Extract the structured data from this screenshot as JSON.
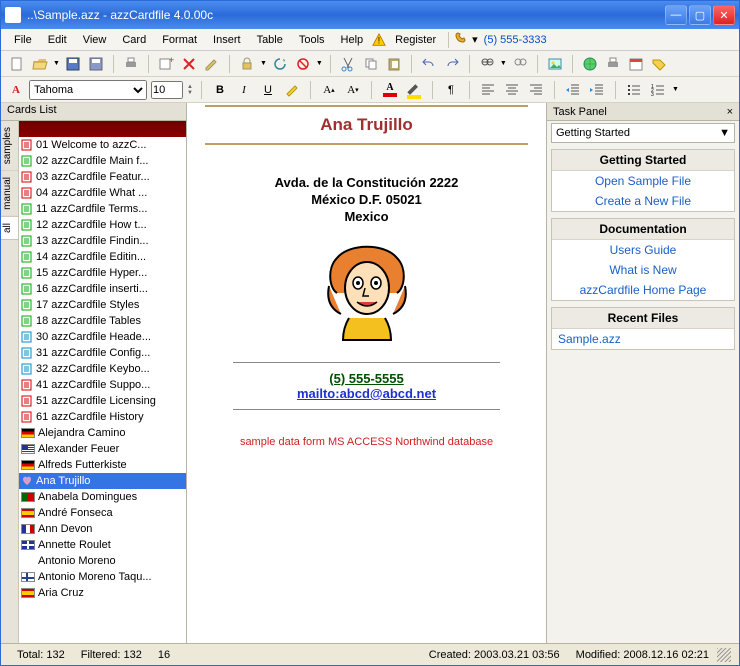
{
  "window": {
    "title": "..\\Sample.azz - azzCardfile 4.0.00c"
  },
  "menu": {
    "items": [
      "File",
      "Edit",
      "View",
      "Card",
      "Format",
      "Insert",
      "Table",
      "Tools",
      "Help"
    ],
    "register": "Register",
    "dial_icon": "phone-icon",
    "dial_number": "(5) 555-3333"
  },
  "format": {
    "font": "Tahoma",
    "size": "10"
  },
  "cards_panel": {
    "title": "Cards List",
    "tabs": [
      "all",
      "manual",
      "samples"
    ],
    "items": [
      {
        "kind": "doc",
        "color": "#c00",
        "label": "01 Welcome to azzC..."
      },
      {
        "kind": "doc",
        "color": "#0a0",
        "label": "02 azzCardfile Main f..."
      },
      {
        "kind": "doc",
        "color": "#c00",
        "label": "03 azzCardfile Featur..."
      },
      {
        "kind": "doc",
        "color": "#c00",
        "label": "04 azzCardfile What ..."
      },
      {
        "kind": "doc",
        "color": "#0a0",
        "label": "11 azzCardfile Terms..."
      },
      {
        "kind": "doc",
        "color": "#0a0",
        "label": "12 azzCardfile How t..."
      },
      {
        "kind": "doc",
        "color": "#0a0",
        "label": "13 azzCardfile Findin..."
      },
      {
        "kind": "doc",
        "color": "#0a0",
        "label": "14 azzCardfile Editin..."
      },
      {
        "kind": "doc",
        "color": "#0a0",
        "label": "15 azzCardfile Hyper..."
      },
      {
        "kind": "doc",
        "color": "#0a0",
        "label": "16 azzCardfile inserti..."
      },
      {
        "kind": "doc",
        "color": "#0a0",
        "label": "17 azzCardfile Styles"
      },
      {
        "kind": "doc",
        "color": "#0a0",
        "label": "18 azzCardfile Tables"
      },
      {
        "kind": "doc",
        "color": "#08c",
        "label": "30 azzCardfile Heade..."
      },
      {
        "kind": "doc",
        "color": "#08c",
        "label": "31 azzCardfile Config..."
      },
      {
        "kind": "doc",
        "color": "#08c",
        "label": "32 azzCardfile Keybo..."
      },
      {
        "kind": "doc",
        "color": "#c00",
        "label": "41 azzCardfile Suppo..."
      },
      {
        "kind": "doc",
        "color": "#c00",
        "label": "51 azzCardfile Licensing"
      },
      {
        "kind": "doc",
        "color": "#c00",
        "label": "61 azzCardfile History"
      },
      {
        "kind": "flag",
        "flag": "de",
        "label": "Alejandra Camino"
      },
      {
        "kind": "flag",
        "flag": "us",
        "label": "Alexander Feuer"
      },
      {
        "kind": "flag",
        "flag": "de",
        "label": "Alfreds Futterkiste"
      },
      {
        "kind": "heart",
        "label": "Ana Trujillo",
        "selected": true
      },
      {
        "kind": "flag",
        "flag": "pt",
        "label": "Anabela Domingues"
      },
      {
        "kind": "flag",
        "flag": "es",
        "label": "André Fonseca"
      },
      {
        "kind": "flag",
        "flag": "fr",
        "label": "Ann Devon"
      },
      {
        "kind": "flag",
        "flag": "uk",
        "label": "Annette Roulet"
      },
      {
        "kind": "none",
        "label": "Antonio Moreno"
      },
      {
        "kind": "flag",
        "flag": "fi",
        "label": "Antonio Moreno Taqu..."
      },
      {
        "kind": "flag",
        "flag": "es",
        "label": "Aria Cruz"
      }
    ]
  },
  "card": {
    "title": "Ana Trujillo",
    "addr1": "Avda. de la Constitución 2222",
    "addr2": "México D.F.  05021",
    "addr3": "Mexico",
    "phone": "(5) 555-5555",
    "email": "mailto:abcd@abcd.net",
    "note": "sample data form MS ACCESS Northwind database"
  },
  "task": {
    "title": "Task Panel",
    "dropdown": "Getting Started",
    "groups": [
      {
        "heading": "Getting Started",
        "links": [
          "Open Sample File",
          "Create a New File"
        ]
      },
      {
        "heading": "Documentation",
        "links": [
          "Users Guide",
          "What is New",
          "azzCardfile Home Page"
        ]
      },
      {
        "heading": "Recent Files",
        "links": [
          "Sample.azz"
        ],
        "align": "left"
      }
    ]
  },
  "status": {
    "total_label": "Total:",
    "total": "132",
    "filtered_label": "Filtered:",
    "filtered": "132",
    "pos": "16",
    "created_label": "Created:",
    "created": "2003.03.21 03:56",
    "modified_label": "Modified:",
    "modified": "2008.12.16 02:21"
  }
}
